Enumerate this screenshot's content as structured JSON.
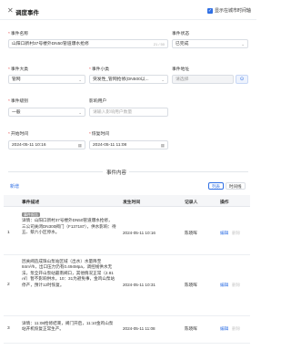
{
  "header": {
    "title": "调度事件",
    "show_map_toggle": "显示在城市时间轴"
  },
  "form": {
    "event_name": {
      "label": "事件名称",
      "value": "山阳口新村37号楼外DN50管道爆水抢修",
      "count": "21 / 50"
    },
    "event_status": {
      "label": "事件状态",
      "value": "已完成"
    },
    "event_category": {
      "label": "事件大类",
      "value": "管网"
    },
    "event_subcategory": {
      "label": "事件小类",
      "value": "突发性_管网抢修(DN500以..."
    },
    "event_address": {
      "label": "事件地址",
      "placeholder": "请选择"
    },
    "event_level": {
      "label": "事件级别",
      "value": "一般"
    },
    "affected_users": {
      "label": "影响用户",
      "placeholder": "请输入影响用户数量"
    },
    "start_time": {
      "label": "开始时间",
      "value": "2024-05-11 10:16"
    },
    "recover_time": {
      "label": "恢复时间",
      "value": "2024-05-11 11:08"
    }
  },
  "events": {
    "section_title": "事件内容",
    "add_label": "新增",
    "view_list": "列表",
    "view_timeline": "时间线",
    "columns": [
      "",
      "事件描述",
      "发生时间",
      "记录人",
      "操作"
    ],
    "rows": [
      {
        "index": "1",
        "tag": "事件报告",
        "description": "详情：山阳口新村37号楼外DN50管道爆水抢修，三公司关闭DN300阀门（F137187），供水影响：待五、蔡六小区停水。",
        "time": "2024-05-11 10:16",
        "recorder": "陈晓晖",
        "edit": "编辑",
        "delete": "删除"
      },
      {
        "index": "2",
        "tag": "",
        "description": "因关阀造成珠山泵站区域（出水）水量降至84m³/h，出口压力仍有0.494Mpa，调控线供水无法，泵全开山泵站最南阀口，其他情况正常（2.81㎡）暂不影响供水，10：31为避免事，金鸡山泵站停产，预计12时恢复。",
        "time": "2024-05-11 10:31",
        "recorder": "陈晓晖",
        "edit": "编辑",
        "delete": "删除"
      },
      {
        "index": "3",
        "tag": "",
        "description": "详情：11:08抢修结束，阀门开启，11:10金鸡山泵站开机恢复正常生产。",
        "time": "2024-05-11 11:08",
        "recorder": "陈晓晖",
        "edit": "编辑",
        "delete": "删除"
      }
    ]
  },
  "colors": {
    "accent": "#2f6fe4",
    "required": "#e54545",
    "tag_bg": "#8e8e8e"
  },
  "icons": [
    "close-icon",
    "checkbox-icon",
    "chevron-down-icon",
    "calendar-icon",
    "location-icon"
  ]
}
